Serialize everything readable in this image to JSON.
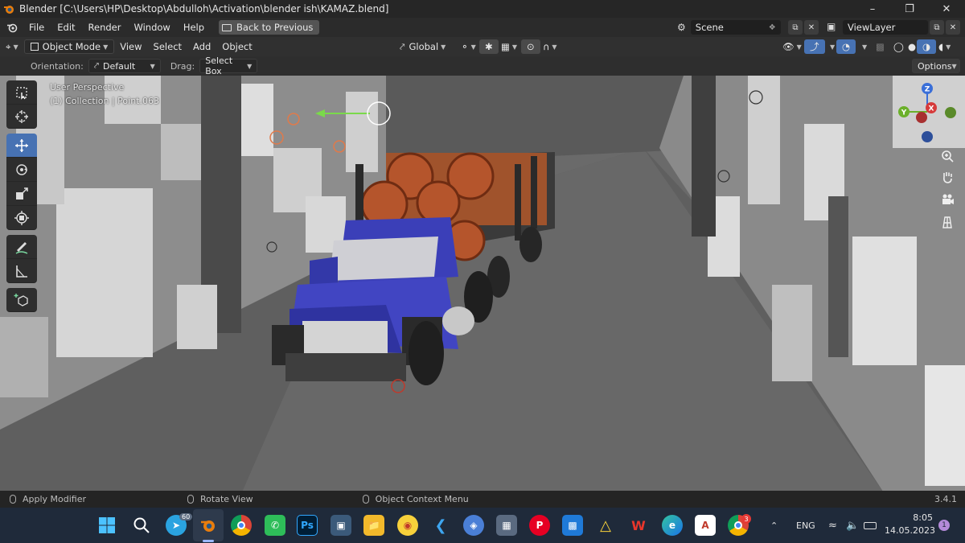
{
  "window": {
    "title": "Blender [C:\\Users\\HP\\Desktop\\Abdulloh\\Activation\\blender ish\\KAMAZ.blend]"
  },
  "menu": {
    "items": [
      "File",
      "Edit",
      "Render",
      "Window",
      "Help"
    ],
    "back_to_previous": "Back to Previous",
    "scene": "Scene",
    "view_layer": "ViewLayer"
  },
  "viewport_header": {
    "mode": "Object Mode",
    "items": [
      "View",
      "Select",
      "Add",
      "Object"
    ],
    "transform": "Global"
  },
  "tool_settings": {
    "orientation_label": "Orientation:",
    "orientation_value": "Default",
    "drag_label": "Drag:",
    "drag_value": "Select Box",
    "options": "Options"
  },
  "viewport": {
    "perspective": "User Perspective",
    "collection": "(1) Collection | Point.063"
  },
  "gizmo": {
    "z": "Z",
    "y": "Y",
    "x": "X"
  },
  "tools": [
    "select-box-icon",
    "cursor-icon",
    "move-icon",
    "rotate-icon",
    "scale-icon",
    "transform-icon",
    "annotate-icon",
    "measure-icon",
    "add-cube-icon"
  ],
  "status_bar": {
    "left": "Apply Modifier",
    "middle": "Rotate View",
    "right": "Object Context Menu",
    "version": "3.4.1"
  },
  "taskbar": {
    "telegram_badge": "60",
    "chrome_badge": "3",
    "ps_label": "Ps",
    "language": "ENG",
    "time": "8:05",
    "date": "14.05.2023",
    "notification_count": "1"
  },
  "colors": {
    "accent": "#4772b3",
    "truck_cab": "#3b3fb8",
    "logs": "#a0532c",
    "taskbar": "#1f2a3a"
  }
}
